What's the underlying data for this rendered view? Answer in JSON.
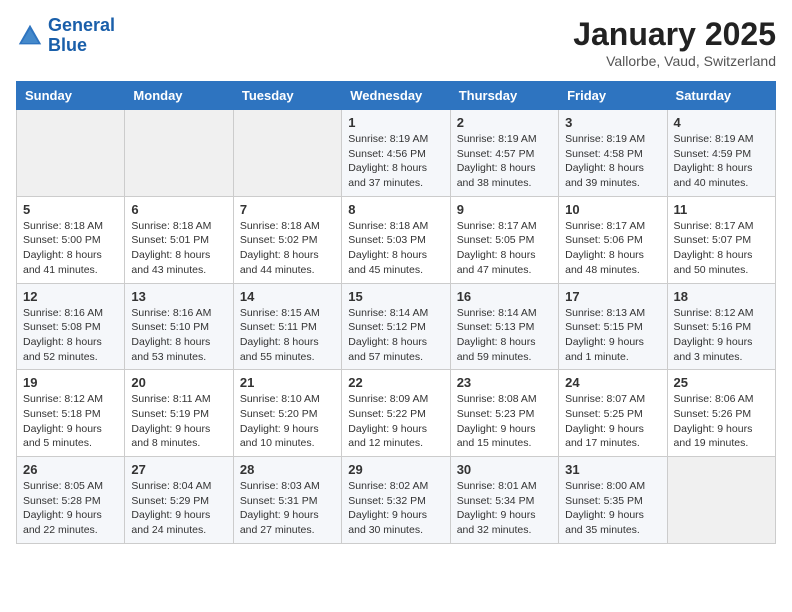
{
  "header": {
    "logo_line1": "General",
    "logo_line2": "Blue",
    "month_title": "January 2025",
    "location": "Vallorbe, Vaud, Switzerland"
  },
  "weekdays": [
    "Sunday",
    "Monday",
    "Tuesday",
    "Wednesday",
    "Thursday",
    "Friday",
    "Saturday"
  ],
  "weeks": [
    [
      {
        "day": "",
        "info": ""
      },
      {
        "day": "",
        "info": ""
      },
      {
        "day": "",
        "info": ""
      },
      {
        "day": "1",
        "info": "Sunrise: 8:19 AM\nSunset: 4:56 PM\nDaylight: 8 hours and 37 minutes."
      },
      {
        "day": "2",
        "info": "Sunrise: 8:19 AM\nSunset: 4:57 PM\nDaylight: 8 hours and 38 minutes."
      },
      {
        "day": "3",
        "info": "Sunrise: 8:19 AM\nSunset: 4:58 PM\nDaylight: 8 hours and 39 minutes."
      },
      {
        "day": "4",
        "info": "Sunrise: 8:19 AM\nSunset: 4:59 PM\nDaylight: 8 hours and 40 minutes."
      }
    ],
    [
      {
        "day": "5",
        "info": "Sunrise: 8:18 AM\nSunset: 5:00 PM\nDaylight: 8 hours and 41 minutes."
      },
      {
        "day": "6",
        "info": "Sunrise: 8:18 AM\nSunset: 5:01 PM\nDaylight: 8 hours and 43 minutes."
      },
      {
        "day": "7",
        "info": "Sunrise: 8:18 AM\nSunset: 5:02 PM\nDaylight: 8 hours and 44 minutes."
      },
      {
        "day": "8",
        "info": "Sunrise: 8:18 AM\nSunset: 5:03 PM\nDaylight: 8 hours and 45 minutes."
      },
      {
        "day": "9",
        "info": "Sunrise: 8:17 AM\nSunset: 5:05 PM\nDaylight: 8 hours and 47 minutes."
      },
      {
        "day": "10",
        "info": "Sunrise: 8:17 AM\nSunset: 5:06 PM\nDaylight: 8 hours and 48 minutes."
      },
      {
        "day": "11",
        "info": "Sunrise: 8:17 AM\nSunset: 5:07 PM\nDaylight: 8 hours and 50 minutes."
      }
    ],
    [
      {
        "day": "12",
        "info": "Sunrise: 8:16 AM\nSunset: 5:08 PM\nDaylight: 8 hours and 52 minutes."
      },
      {
        "day": "13",
        "info": "Sunrise: 8:16 AM\nSunset: 5:10 PM\nDaylight: 8 hours and 53 minutes."
      },
      {
        "day": "14",
        "info": "Sunrise: 8:15 AM\nSunset: 5:11 PM\nDaylight: 8 hours and 55 minutes."
      },
      {
        "day": "15",
        "info": "Sunrise: 8:14 AM\nSunset: 5:12 PM\nDaylight: 8 hours and 57 minutes."
      },
      {
        "day": "16",
        "info": "Sunrise: 8:14 AM\nSunset: 5:13 PM\nDaylight: 8 hours and 59 minutes."
      },
      {
        "day": "17",
        "info": "Sunrise: 8:13 AM\nSunset: 5:15 PM\nDaylight: 9 hours and 1 minute."
      },
      {
        "day": "18",
        "info": "Sunrise: 8:12 AM\nSunset: 5:16 PM\nDaylight: 9 hours and 3 minutes."
      }
    ],
    [
      {
        "day": "19",
        "info": "Sunrise: 8:12 AM\nSunset: 5:18 PM\nDaylight: 9 hours and 5 minutes."
      },
      {
        "day": "20",
        "info": "Sunrise: 8:11 AM\nSunset: 5:19 PM\nDaylight: 9 hours and 8 minutes."
      },
      {
        "day": "21",
        "info": "Sunrise: 8:10 AM\nSunset: 5:20 PM\nDaylight: 9 hours and 10 minutes."
      },
      {
        "day": "22",
        "info": "Sunrise: 8:09 AM\nSunset: 5:22 PM\nDaylight: 9 hours and 12 minutes."
      },
      {
        "day": "23",
        "info": "Sunrise: 8:08 AM\nSunset: 5:23 PM\nDaylight: 9 hours and 15 minutes."
      },
      {
        "day": "24",
        "info": "Sunrise: 8:07 AM\nSunset: 5:25 PM\nDaylight: 9 hours and 17 minutes."
      },
      {
        "day": "25",
        "info": "Sunrise: 8:06 AM\nSunset: 5:26 PM\nDaylight: 9 hours and 19 minutes."
      }
    ],
    [
      {
        "day": "26",
        "info": "Sunrise: 8:05 AM\nSunset: 5:28 PM\nDaylight: 9 hours and 22 minutes."
      },
      {
        "day": "27",
        "info": "Sunrise: 8:04 AM\nSunset: 5:29 PM\nDaylight: 9 hours and 24 minutes."
      },
      {
        "day": "28",
        "info": "Sunrise: 8:03 AM\nSunset: 5:31 PM\nDaylight: 9 hours and 27 minutes."
      },
      {
        "day": "29",
        "info": "Sunrise: 8:02 AM\nSunset: 5:32 PM\nDaylight: 9 hours and 30 minutes."
      },
      {
        "day": "30",
        "info": "Sunrise: 8:01 AM\nSunset: 5:34 PM\nDaylight: 9 hours and 32 minutes."
      },
      {
        "day": "31",
        "info": "Sunrise: 8:00 AM\nSunset: 5:35 PM\nDaylight: 9 hours and 35 minutes."
      },
      {
        "day": "",
        "info": ""
      }
    ]
  ]
}
